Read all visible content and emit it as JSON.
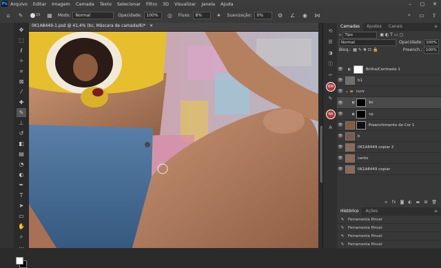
{
  "menu": {
    "app_logo": "Ps",
    "items": [
      "Arquivo",
      "Editar",
      "Imagem",
      "Camada",
      "Texto",
      "Selecionar",
      "Filtro",
      "3D",
      "Visualizar",
      "Janela",
      "Ajuda"
    ],
    "window_controls": [
      "–",
      "▢",
      "✕"
    ]
  },
  "options": {
    "brush_size": "33",
    "mode_label": "Modo:",
    "mode_value": "Normal",
    "opacity_label": "Opacidade:",
    "opacity_value": "100%",
    "flow_label": "Fluxo:",
    "flow_value": "8%",
    "smoothing_label": "Suavização:",
    "smoothing_value": "0%"
  },
  "document": {
    "tab_title": "0K1A8449-1.psd @ 41,4% (bc, Máscara de camada/8)*",
    "close": "✕"
  },
  "layers_panel": {
    "tabs": [
      "Camadas",
      "Ajustes",
      "Canais"
    ],
    "filter_value": "Tipo",
    "blend_mode": "Normal",
    "opacity_label": "Opacidade:",
    "opacity_value": "100%",
    "lock_label": "Bloq.:",
    "fill_label": "Preench.:",
    "fill_value": "100%",
    "layers": [
      {
        "name": "Brilho/Contraste 1",
        "thumb": "#ffffff",
        "kind": "adjustment"
      },
      {
        "name": "b1",
        "thumb": "#6e6e6e",
        "kind": "pixel"
      },
      {
        "name": "curv",
        "thumb": "",
        "kind": "group"
      },
      {
        "name": "bc",
        "thumb": "#000000",
        "kind": "curve",
        "selected": true
      },
      {
        "name": "cp",
        "thumb": "#000000",
        "kind": "curve"
      },
      {
        "name": "Preenchimento de Cor 1",
        "thumb": "#8a5a3c",
        "kind": "fill"
      },
      {
        "name": "b",
        "thumb": "#7a5a4a",
        "kind": "pixel"
      },
      {
        "name": "0K1A8449 copiar 2",
        "thumb": "#8c6a55",
        "kind": "pixel"
      },
      {
        "name": "canto",
        "thumb": "#8c6a55",
        "kind": "pixel"
      },
      {
        "name": "0K1A8449 copiar",
        "thumb": "#8c6a55",
        "kind": "pixel"
      }
    ]
  },
  "history_panel": {
    "tabs": [
      "Histórico",
      "Ações"
    ],
    "items": [
      "Ferramenta Pincel",
      "Ferramenta Pincel",
      "Ferramenta Pincel",
      "Ferramenta Pincel"
    ]
  },
  "side_badges": [
    "BM",
    "RA"
  ],
  "colors": {
    "fg": "#ffffff",
    "bg": "#000000",
    "accent": "#31a8ff"
  }
}
